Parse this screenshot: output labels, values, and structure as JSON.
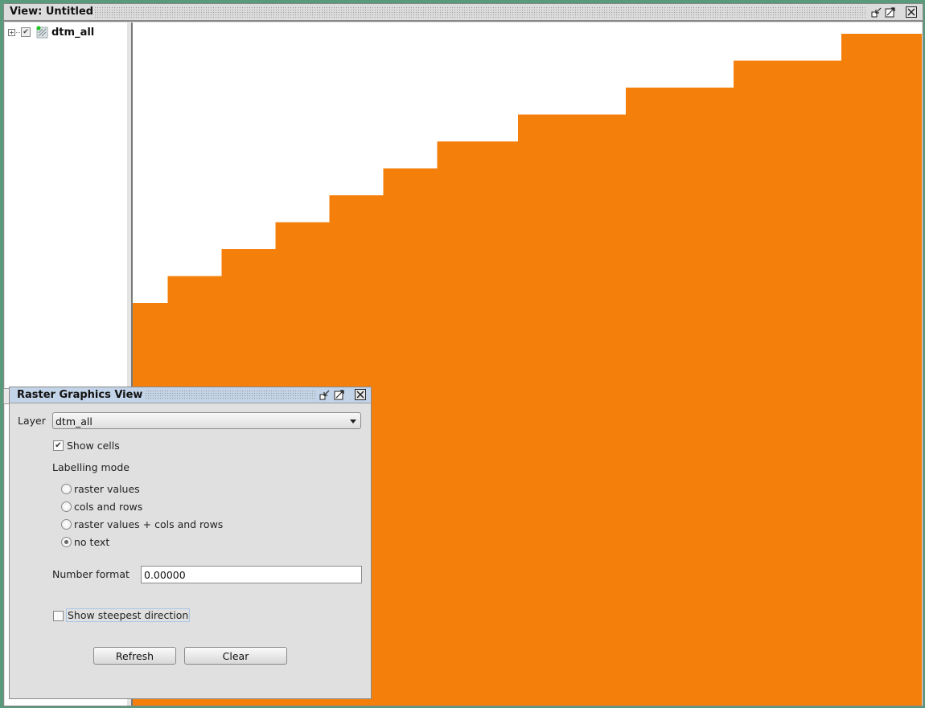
{
  "view": {
    "title": "View: Untitled",
    "buttons": [
      "iconify-icon",
      "maximize-icon",
      "close-icon"
    ]
  },
  "toc": {
    "layers": [
      {
        "name": "dtm_all",
        "visible": true,
        "expanded": false
      }
    ]
  },
  "map": {
    "fill_color": "#f4800b",
    "background_color": "#ffffff",
    "staircase_steps": [
      {
        "col": 0,
        "row": 10
      },
      {
        "col": 1,
        "row": 9
      },
      {
        "col": 3,
        "row": 8
      },
      {
        "col": 5,
        "row": 7
      },
      {
        "col": 7,
        "row": 6
      },
      {
        "col": 9,
        "row": 5
      },
      {
        "col": 11,
        "row": 4
      },
      {
        "col": 14,
        "row": 3
      },
      {
        "col": 18,
        "row": 2
      },
      {
        "col": 22,
        "row": 1
      },
      {
        "col": 26,
        "row": 0
      }
    ]
  },
  "raster_graphics_view": {
    "title": "Raster Graphics View",
    "layer_label": "Layer",
    "layer_value": "dtm_all",
    "show_cells_label": "Show cells",
    "show_cells_checked": true,
    "labelling_mode_label": "Labelling mode",
    "labelling_options": [
      {
        "label": "raster values",
        "selected": false
      },
      {
        "label": "cols and rows",
        "selected": false
      },
      {
        "label": "raster values + cols and rows",
        "selected": false
      },
      {
        "label": "no text",
        "selected": true
      }
    ],
    "number_format_label": "Number format",
    "number_format_value": "0.00000",
    "show_steepest_label": "Show steepest direction",
    "show_steepest_checked": false,
    "refresh_label": "Refresh",
    "clear_label": "Clear"
  }
}
